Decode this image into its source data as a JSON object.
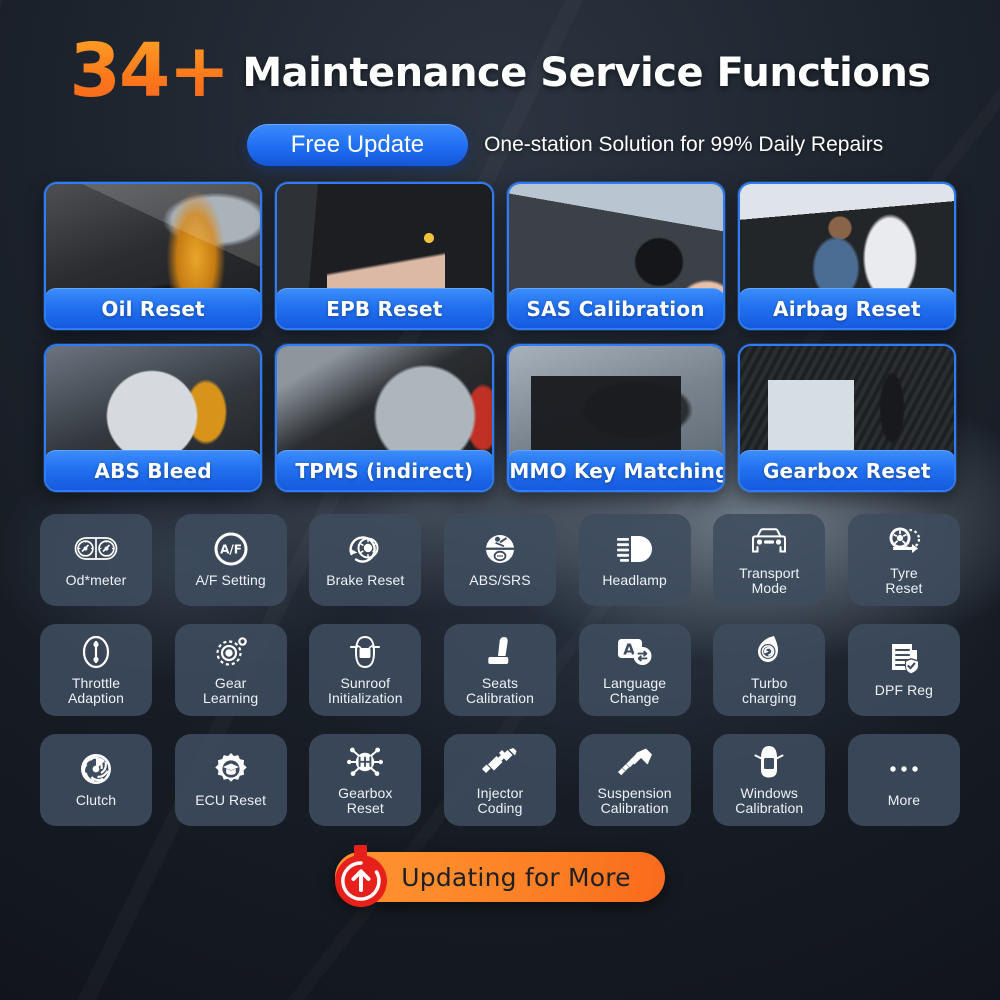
{
  "header": {
    "count": "34+",
    "title": "Maintenance Service Functions",
    "free_update_label": "Free Update",
    "subtitle": "One-station Solution for 99% Daily Repairs"
  },
  "photo_cards": [
    [
      {
        "label": "Oil Reset",
        "image": "engine-oil-pouring-photo"
      },
      {
        "label": "EPB Reset",
        "image": "electronic-parking-brake-button-photo"
      },
      {
        "label": "SAS Calibration",
        "image": "steering-wheel-hands-photo"
      },
      {
        "label": "Airbag Reset",
        "image": "airbag-deployment-photo"
      }
    ],
    [
      {
        "label": "ABS Bleed",
        "image": "brake-disc-caliper-photo"
      },
      {
        "label": "TPMS (indirect)",
        "image": "alloy-wheel-tyre-photo"
      },
      {
        "label": "IMMO Key Matching",
        "image": "car-smart-key-photo"
      },
      {
        "label": "Gearbox Reset",
        "image": "gear-shifter-console-photo"
      }
    ]
  ],
  "function_grid": [
    [
      {
        "label": "Od*meter",
        "icon": "odometer-gauges-icon"
      },
      {
        "label": "A/F Setting",
        "icon": "air-fuel-ratio-icon"
      },
      {
        "label": "Brake Reset",
        "icon": "brake-disc-reset-icon"
      },
      {
        "label": "ABS/SRS",
        "icon": "abs-srs-airbag-icon"
      },
      {
        "label": "Headlamp",
        "icon": "headlamp-beam-icon"
      },
      {
        "label": "Transport\nMode",
        "icon": "car-front-icon"
      },
      {
        "label": "Tyre\nReset",
        "icon": "tyre-reset-icon"
      }
    ],
    [
      {
        "label": "Throttle\nAdaption",
        "icon": "throttle-body-icon"
      },
      {
        "label": "Gear\nLearning",
        "icon": "gear-cog-icon"
      },
      {
        "label": "Sunroof\nInitialization",
        "icon": "car-sunroof-top-icon"
      },
      {
        "label": "Seats\nCalibration",
        "icon": "car-seat-icon"
      },
      {
        "label": "Language\nChange",
        "icon": "language-swap-icon"
      },
      {
        "label": "Turbo\ncharging",
        "icon": "turbocharger-icon"
      },
      {
        "label": "DPF Reg",
        "icon": "document-shield-check-icon"
      }
    ],
    [
      {
        "label": "Clutch",
        "icon": "clutch-plate-icon"
      },
      {
        "label": "ECU Reset",
        "icon": "ecu-gear-graduate-icon"
      },
      {
        "label": "Gearbox\nReset",
        "icon": "gearbox-shift-pattern-icon"
      },
      {
        "label": "Injector\nCoding",
        "icon": "fuel-injector-icon"
      },
      {
        "label": "Suspension\nCalibration",
        "icon": "suspension-shock-icon"
      },
      {
        "label": "Windows\nCalibration",
        "icon": "car-windows-top-icon"
      },
      {
        "label": "More",
        "icon": "ellipsis-more-icon"
      }
    ]
  ],
  "cta": {
    "label": "Updating for More",
    "badge_icon": "upload-arrow-timer-icon"
  },
  "colors": {
    "accent_orange": "#fb7b22",
    "accent_blue": "#2171f0",
    "card_border_blue": "#2f7df5",
    "tile_bg": "#3e4c5f",
    "page_bg": "#14181f",
    "text_white": "#ffffff",
    "badge_red": "#e8201c"
  }
}
